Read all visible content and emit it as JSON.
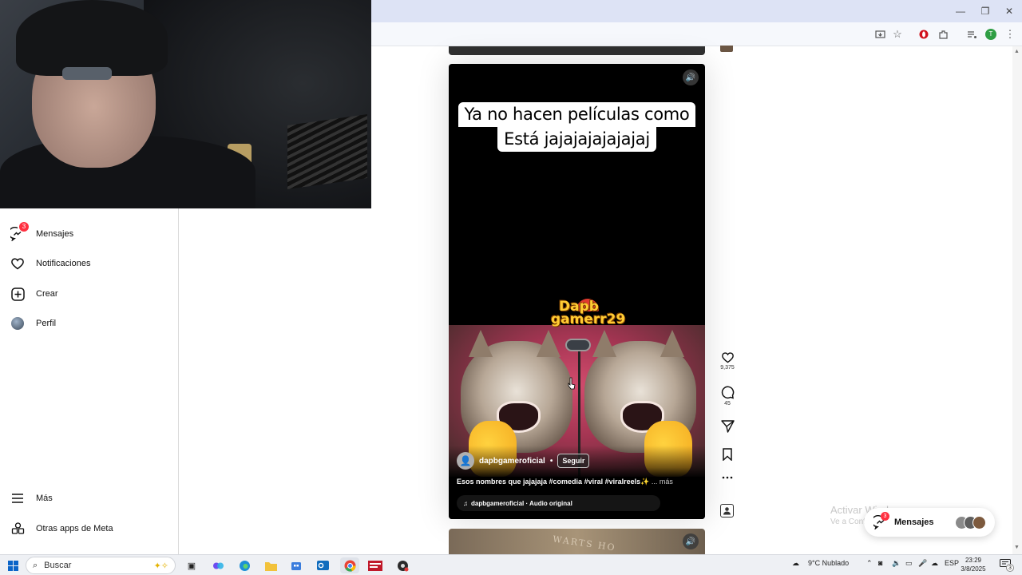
{
  "browser": {
    "window_controls": {
      "minimize": "—",
      "restore": "❐",
      "close": "✕"
    },
    "toolbar_icons": [
      "install-app-icon",
      "star-icon",
      "opera-icon",
      "extensions-icon",
      "media-icon",
      "profile-icon",
      "menu-icon"
    ],
    "profile_initial": "T"
  },
  "sidebar": {
    "items_top": [
      {
        "label": "Mensajes",
        "icon": "messenger-icon",
        "badge": "3"
      },
      {
        "label": "Notificaciones",
        "icon": "heart-icon"
      },
      {
        "label": "Crear",
        "icon": "plus-square-icon"
      },
      {
        "label": "Perfil",
        "icon": "avatar"
      }
    ],
    "items_bottom": [
      {
        "label": "Más",
        "icon": "hamburger-icon"
      },
      {
        "label": "Otras apps de Meta",
        "icon": "meta-apps-icon"
      }
    ]
  },
  "reel": {
    "caption_line1": "Ya no hacen películas como",
    "caption_line2": "Está jajajajajajajaj",
    "logo_text_line1": "Dapb",
    "logo_text_line2": "gamerr29",
    "username": "dapbgameroficial",
    "dot": "•",
    "follow_label": "Seguir",
    "description": "Esos nombres que jajajaja #comedia #viral #viralreels✨",
    "more_label": "... más",
    "audio": "dapbgameroficial · Audio original"
  },
  "actions": {
    "likes": "9,375",
    "comments": "45"
  },
  "next_reel": {
    "visible_text": "WARTS HO"
  },
  "watermark": {
    "title": "Activar Windows",
    "subtitle": "Ve a Configuración para activar Windows."
  },
  "messages_pill": {
    "label": "Mensajes",
    "badge": "3"
  },
  "taskbar": {
    "search_placeholder": "Buscar",
    "weather": "9°C  Nublado",
    "language": "ESP",
    "time": "23:29",
    "date": "3/8/2025",
    "notifications": "3"
  }
}
